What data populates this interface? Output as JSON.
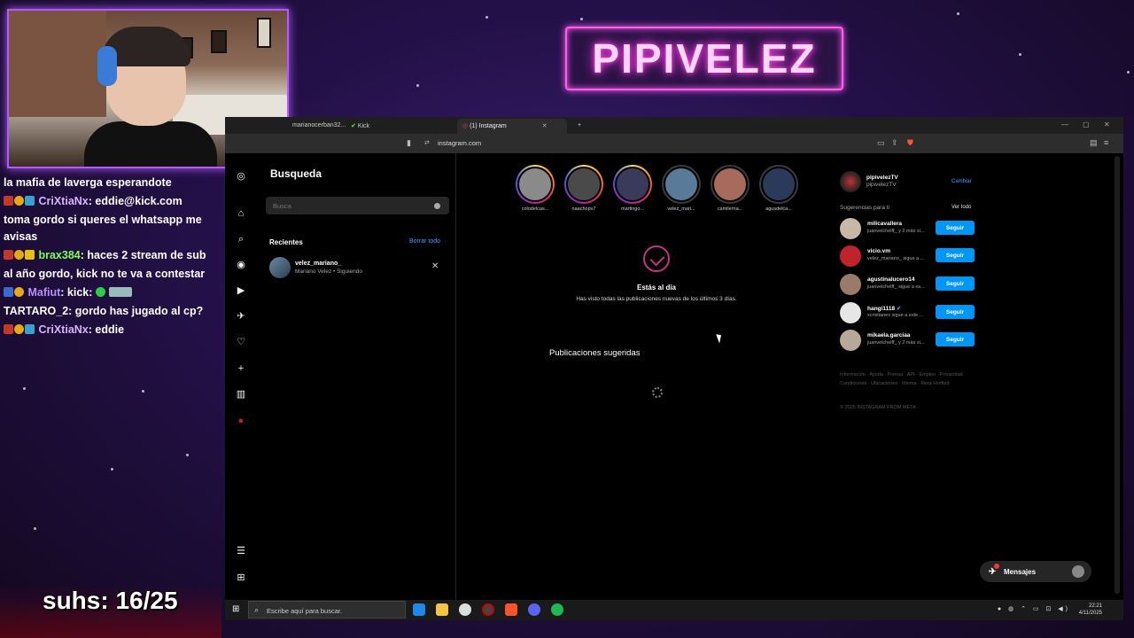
{
  "overlay": {
    "logo_text": "PIPIVELEZ",
    "subs_text": "suhs: 16/25"
  },
  "chat": {
    "lines": [
      {
        "user": "",
        "user_color": "#ffffff",
        "text": "la mafia de laverga esperandote"
      },
      {
        "user": "CriXtiaNx",
        "user_color": "#d8b4ff",
        "text": ": eddie@kick.com"
      },
      {
        "user": "",
        "user_color": "#ffffff",
        "text": "toma gordo si queres el whatsapp me avisas"
      },
      {
        "user": "brax384",
        "user_color": "#7fff5a",
        "text": ": haces 2 stream de sub"
      },
      {
        "user": "",
        "user_color": "#ffffff",
        "text": "al año gordo, kick no te va a contestar"
      },
      {
        "user": "Mafiut",
        "user_color": "#b98cff",
        "text": ":  kick:"
      },
      {
        "user": "TARTARO_2",
        "user_color": "#ffffff",
        "text": ": gordo has jugado al cp?"
      },
      {
        "user": "CriXtiaNx",
        "user_color": "#d8b4ff",
        "text": ": eddie"
      }
    ]
  },
  "browser": {
    "tabs": [
      {
        "label": "marianocerban32...",
        "active": false
      },
      {
        "label": "Kick",
        "active": false
      },
      {
        "label": "(1) Instagram",
        "active": true
      }
    ],
    "url": "instagram.com"
  },
  "instagram": {
    "search": {
      "title": "Busqueda",
      "placeholder": "Busca",
      "recent_label": "Recientes",
      "clear_all": "Borrar todo",
      "recent_user": "velez_mariano_",
      "recent_sub": "Mariano Velez • Siguiendo"
    },
    "stories": [
      {
        "name": "colodelcas...",
        "seen": false,
        "color": "#8a8a8a"
      },
      {
        "name": "naachopv7",
        "seen": false,
        "color": "#4a4a4a"
      },
      {
        "name": "martingo...",
        "seen": false,
        "color": "#3a3a5a"
      },
      {
        "name": "velez_mari...",
        "seen": true,
        "color": "#5a7a9a"
      },
      {
        "name": "camilerna...",
        "seen": true,
        "color": "#a86a5a"
      },
      {
        "name": "agusdelca...",
        "seen": true,
        "color": "#2a3a5a"
      }
    ],
    "caught_up": {
      "title": "Estás al día",
      "subtitle": "Has visto todas las publicaciones nuevas de los últimos 3 días."
    },
    "suggested_posts": "Publicaciones sugeridas",
    "profile": {
      "username": "pipivelezTV",
      "name": "pipivelezTV",
      "switch": "Cambiar"
    },
    "suggestions_label": "Sugerencias para ti",
    "see_all": "Ver todo",
    "suggestions": [
      {
        "username": "milicavallera",
        "meta": "juanvelchelff_ y 2 más si...",
        "follow": "Seguir",
        "color": "#c9b8a8"
      },
      {
        "username": "vicio.vm",
        "meta": "velez_mariano_ sigue a ...",
        "follow": "Seguir",
        "color": "#c0242a"
      },
      {
        "username": "agustinalucero14",
        "meta": "juanvelchelff_ sigue a es...",
        "follow": "Seguir",
        "color": "#9a7a6a"
      },
      {
        "username": "hangi1118",
        "meta": "xcristianex sigue a este ...",
        "follow": "Seguir",
        "color": "#e6e6e6"
      },
      {
        "username": "mikaela.garciaa",
        "meta": "juanvelchelff_ y 2 más si...",
        "follow": "Seguir",
        "color": "#b8a898"
      }
    ],
    "footer_links": "Información · Ayuda · Prensa · API · Empleo · Privacidad · Condiciones · Ubicaciones · Idioma · Meta Verified",
    "copyright": "© 2025 INSTAGRAM FROM META",
    "messages": "Mensajes"
  },
  "taskbar": {
    "search_placeholder": "Escribe aquí para buscar.",
    "time": "22:21",
    "date": "4/11/2025"
  }
}
